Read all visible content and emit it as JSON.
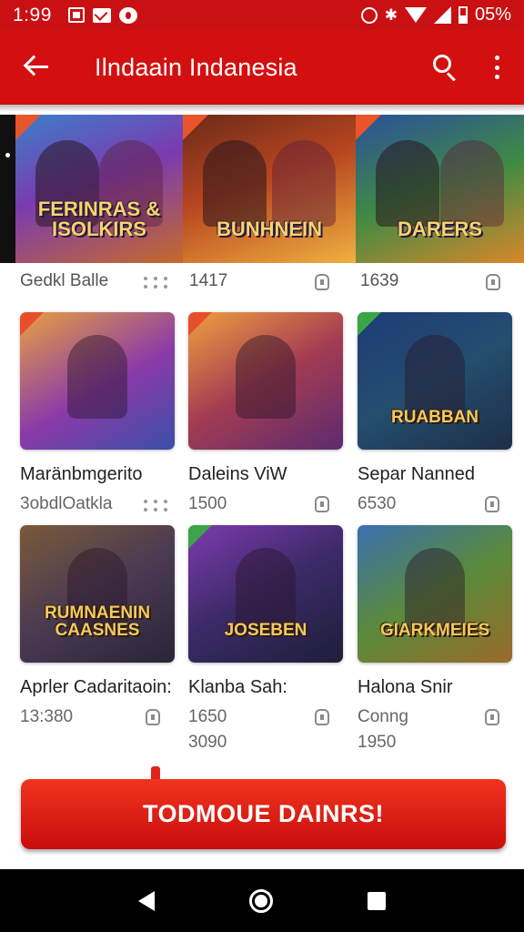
{
  "status_bar": {
    "time": "1:99",
    "battery": "05%",
    "bluetooth_symbol": "✱",
    "icons": [
      "notification-box-icon",
      "mail-icon",
      "app-circle-icon",
      "alarm-icon",
      "bluetooth-icon",
      "wifi-icon",
      "signal-icon",
      "battery-icon"
    ]
  },
  "app_bar": {
    "title": "Ilndaain Indanesia",
    "icons": [
      "back-arrow-icon",
      "search-icon",
      "more-vert-icon"
    ],
    "color": "#d3100f"
  },
  "banners": [
    {
      "title": "FERINRAS & ISOLKIRS",
      "label": "Gedkl Balle"
    },
    {
      "title": "BUNHNEIN",
      "label": "1417"
    },
    {
      "title": "DARERS",
      "label": "1639"
    }
  ],
  "games": [
    {
      "art_title": "",
      "name": "Maränbmgerito",
      "meta": "3obdlOatkla",
      "extra": ""
    },
    {
      "art_title": "",
      "name": "Daleins ViW",
      "meta": "1500",
      "extra": ""
    },
    {
      "art_title": "RUABBAN",
      "name": "Separ Nanned",
      "meta": "6530",
      "extra": ""
    },
    {
      "art_title": "RUMNAENIN CAASNES",
      "name": "Aprler Cadaritaoin:",
      "meta": "13:380",
      "extra": ""
    },
    {
      "art_title": "JOSEBEN",
      "name": "Klanba Sah:",
      "meta": "1650",
      "extra": "3090"
    },
    {
      "art_title": "GIARKMEIES",
      "name": "Halona Snir",
      "meta": "Conng",
      "extra": "1950"
    }
  ],
  "cta": {
    "label": "TODMOUE DAINRS!",
    "color": "#e3221c"
  },
  "nav_bar": {
    "icons": [
      "nav-back-icon",
      "nav-home-icon",
      "nav-recents-icon"
    ]
  }
}
